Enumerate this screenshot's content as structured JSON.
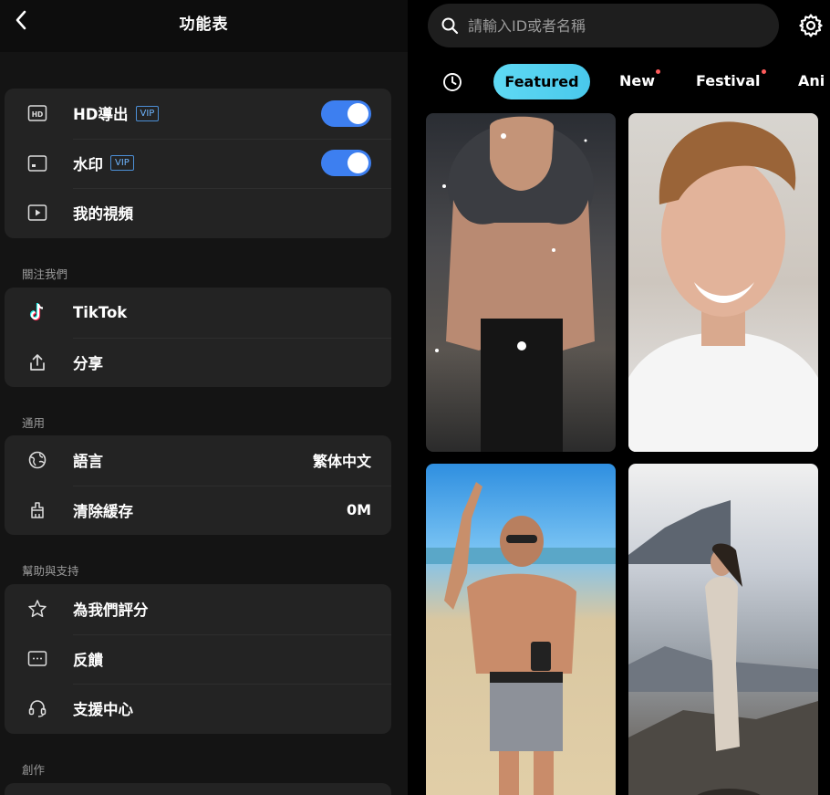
{
  "menu": {
    "title": "功能表",
    "group1": [
      {
        "label": "HD導出",
        "badge": "VIP",
        "icon": "hd-icon",
        "toggle": true
      },
      {
        "label": "水印",
        "badge": "VIP",
        "icon": "watermark-icon",
        "toggle": true
      },
      {
        "label": "我的視頻",
        "icon": "video-play-icon"
      }
    ],
    "section_follow": "關注我們",
    "group2": [
      {
        "label": "TikTok",
        "icon": "tiktok-icon"
      },
      {
        "label": "分享",
        "icon": "share-icon"
      }
    ],
    "section_general": "通用",
    "group3": [
      {
        "label": "語言",
        "value": "繁体中文",
        "icon": "globe-icon"
      },
      {
        "label": "清除緩存",
        "value": "0M",
        "icon": "broom-icon"
      }
    ],
    "section_help": "幫助與支持",
    "group4": [
      {
        "label": "為我們評分",
        "icon": "star-icon"
      },
      {
        "label": "反饋",
        "icon": "feedback-icon"
      },
      {
        "label": "支援中心",
        "icon": "headset-icon"
      }
    ],
    "section_create": "創作"
  },
  "browser": {
    "search_placeholder": "請輸入ID或者名稱",
    "tabs": [
      {
        "label": "Featured",
        "active": true
      },
      {
        "label": "New",
        "dot": true
      },
      {
        "label": "Festival",
        "dot": true
      },
      {
        "label": "Ani"
      }
    ]
  },
  "colors": {
    "accent": "#4ac8ec",
    "toggle_on": "#3d7ff0",
    "vip": "#6eb5ff",
    "dot": "#ff5b5b"
  }
}
